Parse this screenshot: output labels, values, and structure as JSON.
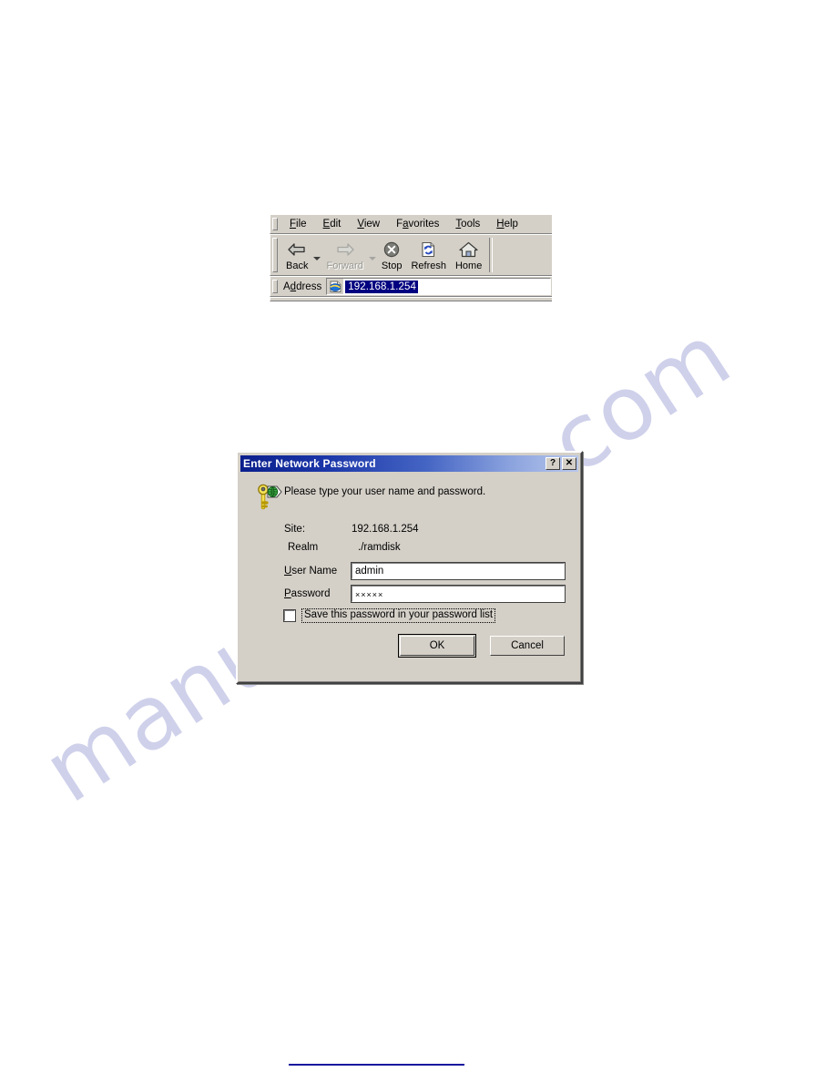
{
  "watermark": {
    "text": "manualshive.com",
    "color": "#c9cbe9"
  },
  "browser": {
    "menu": [
      {
        "pre": "",
        "accel": "F",
        "post": "ile"
      },
      {
        "pre": "",
        "accel": "E",
        "post": "dit"
      },
      {
        "pre": "",
        "accel": "V",
        "post": "iew"
      },
      {
        "pre": "F",
        "accel": "a",
        "post": "vorites"
      },
      {
        "pre": "",
        "accel": "T",
        "post": "ools"
      },
      {
        "pre": "",
        "accel": "H",
        "post": "elp"
      }
    ],
    "toolbar": [
      {
        "label": "Back",
        "icon": "back-arrow-icon",
        "enabled": true,
        "dropdown": true
      },
      {
        "label": "Forward",
        "icon": "forward-arrow-icon",
        "enabled": false,
        "dropdown": true
      },
      {
        "label": "Stop",
        "icon": "stop-icon",
        "enabled": true,
        "dropdown": false
      },
      {
        "label": "Refresh",
        "icon": "refresh-icon",
        "enabled": true,
        "dropdown": false
      },
      {
        "label": "Home",
        "icon": "home-icon",
        "enabled": true,
        "dropdown": false
      }
    ],
    "address": {
      "label_pre": "A",
      "label_accel": "d",
      "label_post": "dress",
      "value": "192.168.1.254",
      "selected": true,
      "icon": "internet-explorer-icon",
      "selection_color": "#000080"
    }
  },
  "dialog": {
    "title": "Enter Network Password",
    "title_buttons": [
      {
        "name": "help-button",
        "glyph": "?"
      },
      {
        "name": "close-button",
        "glyph": "✕"
      }
    ],
    "icon": "key-and-globe-icon",
    "prompt": "Please type your user name and password.",
    "site_label": "Site:",
    "site_value": "192.168.1.254",
    "realm_label": "Realm",
    "realm_value": "./ramdisk",
    "username": {
      "label_accel": "U",
      "label_rest": "ser Name",
      "value": "admin",
      "placeholder": ""
    },
    "password": {
      "label_accel": "P",
      "label_rest": "assword",
      "value": "×××××",
      "placeholder": ""
    },
    "save_checkbox": {
      "label": "Save this password in your password list",
      "checked": false
    },
    "ok_label": "OK",
    "cancel_label": "Cancel"
  }
}
